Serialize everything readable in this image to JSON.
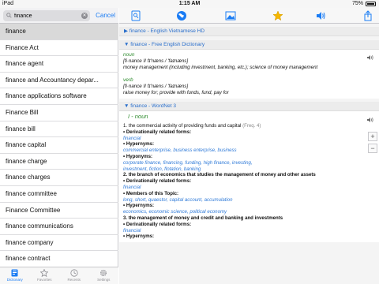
{
  "status": {
    "carrier": "iPad",
    "time": "1:15 AM",
    "battery": "75%"
  },
  "search": {
    "value": "finance",
    "cancel_label": "Cancel"
  },
  "words": [
    "finance",
    "Finance Act",
    "finance agent",
    "finance and Accountancy depar...",
    "finance applications software",
    "Finance Bill",
    "finance bill",
    "finance capital",
    "finance charge",
    "finance charges",
    "finance committee",
    "Finance Committee",
    "finance communications",
    "finance company",
    "finance contract"
  ],
  "tabs": [
    {
      "label": "Dictionary",
      "icon": "dictionary-icon"
    },
    {
      "label": "Favorites",
      "icon": "star-outline-icon"
    },
    {
      "label": "Recents",
      "icon": "clock-icon"
    },
    {
      "label": "Settings",
      "icon": "gear-icon"
    }
  ],
  "toolbar_icons": [
    "word-search-icon",
    "globe-icon",
    "image-icon",
    "star-icon",
    "speaker-icon",
    "share-icon"
  ],
  "colors": {
    "accent": "#1a7cf4",
    "link": "#2f7ad8",
    "pos": "#2e8b2e",
    "section": "#2a6fcc"
  },
  "sections": {
    "s1": "finance - English Vietnamese HD",
    "s2": "finance - Free English Dictionary",
    "s3": "finance - WordNet 3"
  },
  "free": {
    "noun_pos": "noun",
    "noun_pron": "[fi·nance II fɪ'næns / 'faɪnæns]",
    "noun_def": "money management (including investment, banking, etc.); science of money management",
    "verb_pos": "verb",
    "verb_pron": "[fi·nance II fɪ'næns / 'faɪnæns]",
    "verb_def": "raise money for; provide with funds, fund, pay for"
  },
  "wordnet": {
    "title": "I - noun",
    "l1": "1. the commercial activity of providing funds and capital",
    "l1_freq": "(Freq. 4)",
    "derivationally": "• Derivationally related forms:",
    "hypernyms": "• Hypernyms:",
    "hyponyms": "• Hyponyms:",
    "members": "• Members of this Topic:",
    "d1": "financial",
    "h1": "commercial enterprise, business enterprise, business",
    "hy1": "corporate finance, financing, funding, high finance, investing,",
    "hy2": "investment, fiction, flotation, banking",
    "l2": "2. the branch of economics that studies the management of money and other assets",
    "d2": "financial",
    "m2": "long, short, quaestor, capital account, accumulation",
    "h2": "economics, economic science, political economy",
    "l3": "3. the management of money and credit and banking and investments",
    "d3": "financial",
    "h3_cut": "• Hypernyms:"
  }
}
